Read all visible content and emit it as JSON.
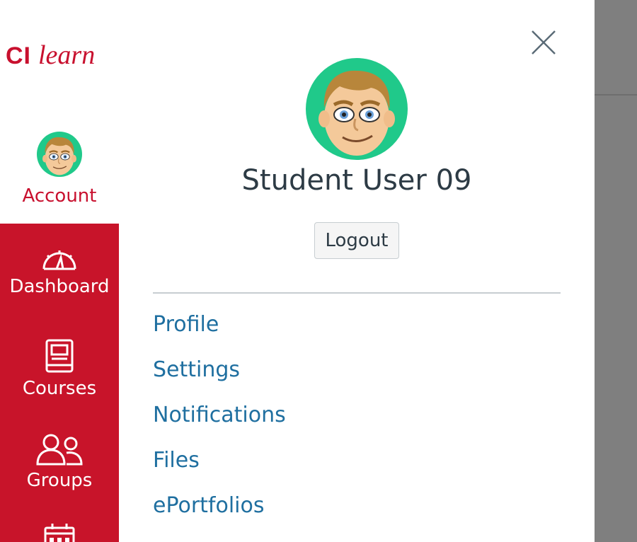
{
  "brand": {
    "logo_ci": "CI",
    "logo_learn": "learn",
    "color": "#c8102e"
  },
  "global_nav": {
    "account_label": "Account",
    "items": [
      {
        "label": "Dashboard",
        "icon": "dashboard-icon"
      },
      {
        "label": "Courses",
        "icon": "courses-icon"
      },
      {
        "label": "Groups",
        "icon": "groups-icon"
      },
      {
        "label": "",
        "icon": "calendar-icon"
      }
    ]
  },
  "tray": {
    "user_name": "Student User 09",
    "logout_label": "Logout",
    "links": [
      {
        "label": "Profile"
      },
      {
        "label": "Settings"
      },
      {
        "label": "Notifications"
      },
      {
        "label": "Files"
      },
      {
        "label": "ePortfolios"
      }
    ],
    "close_icon": "close-icon",
    "link_color": "#1f6fa0"
  }
}
